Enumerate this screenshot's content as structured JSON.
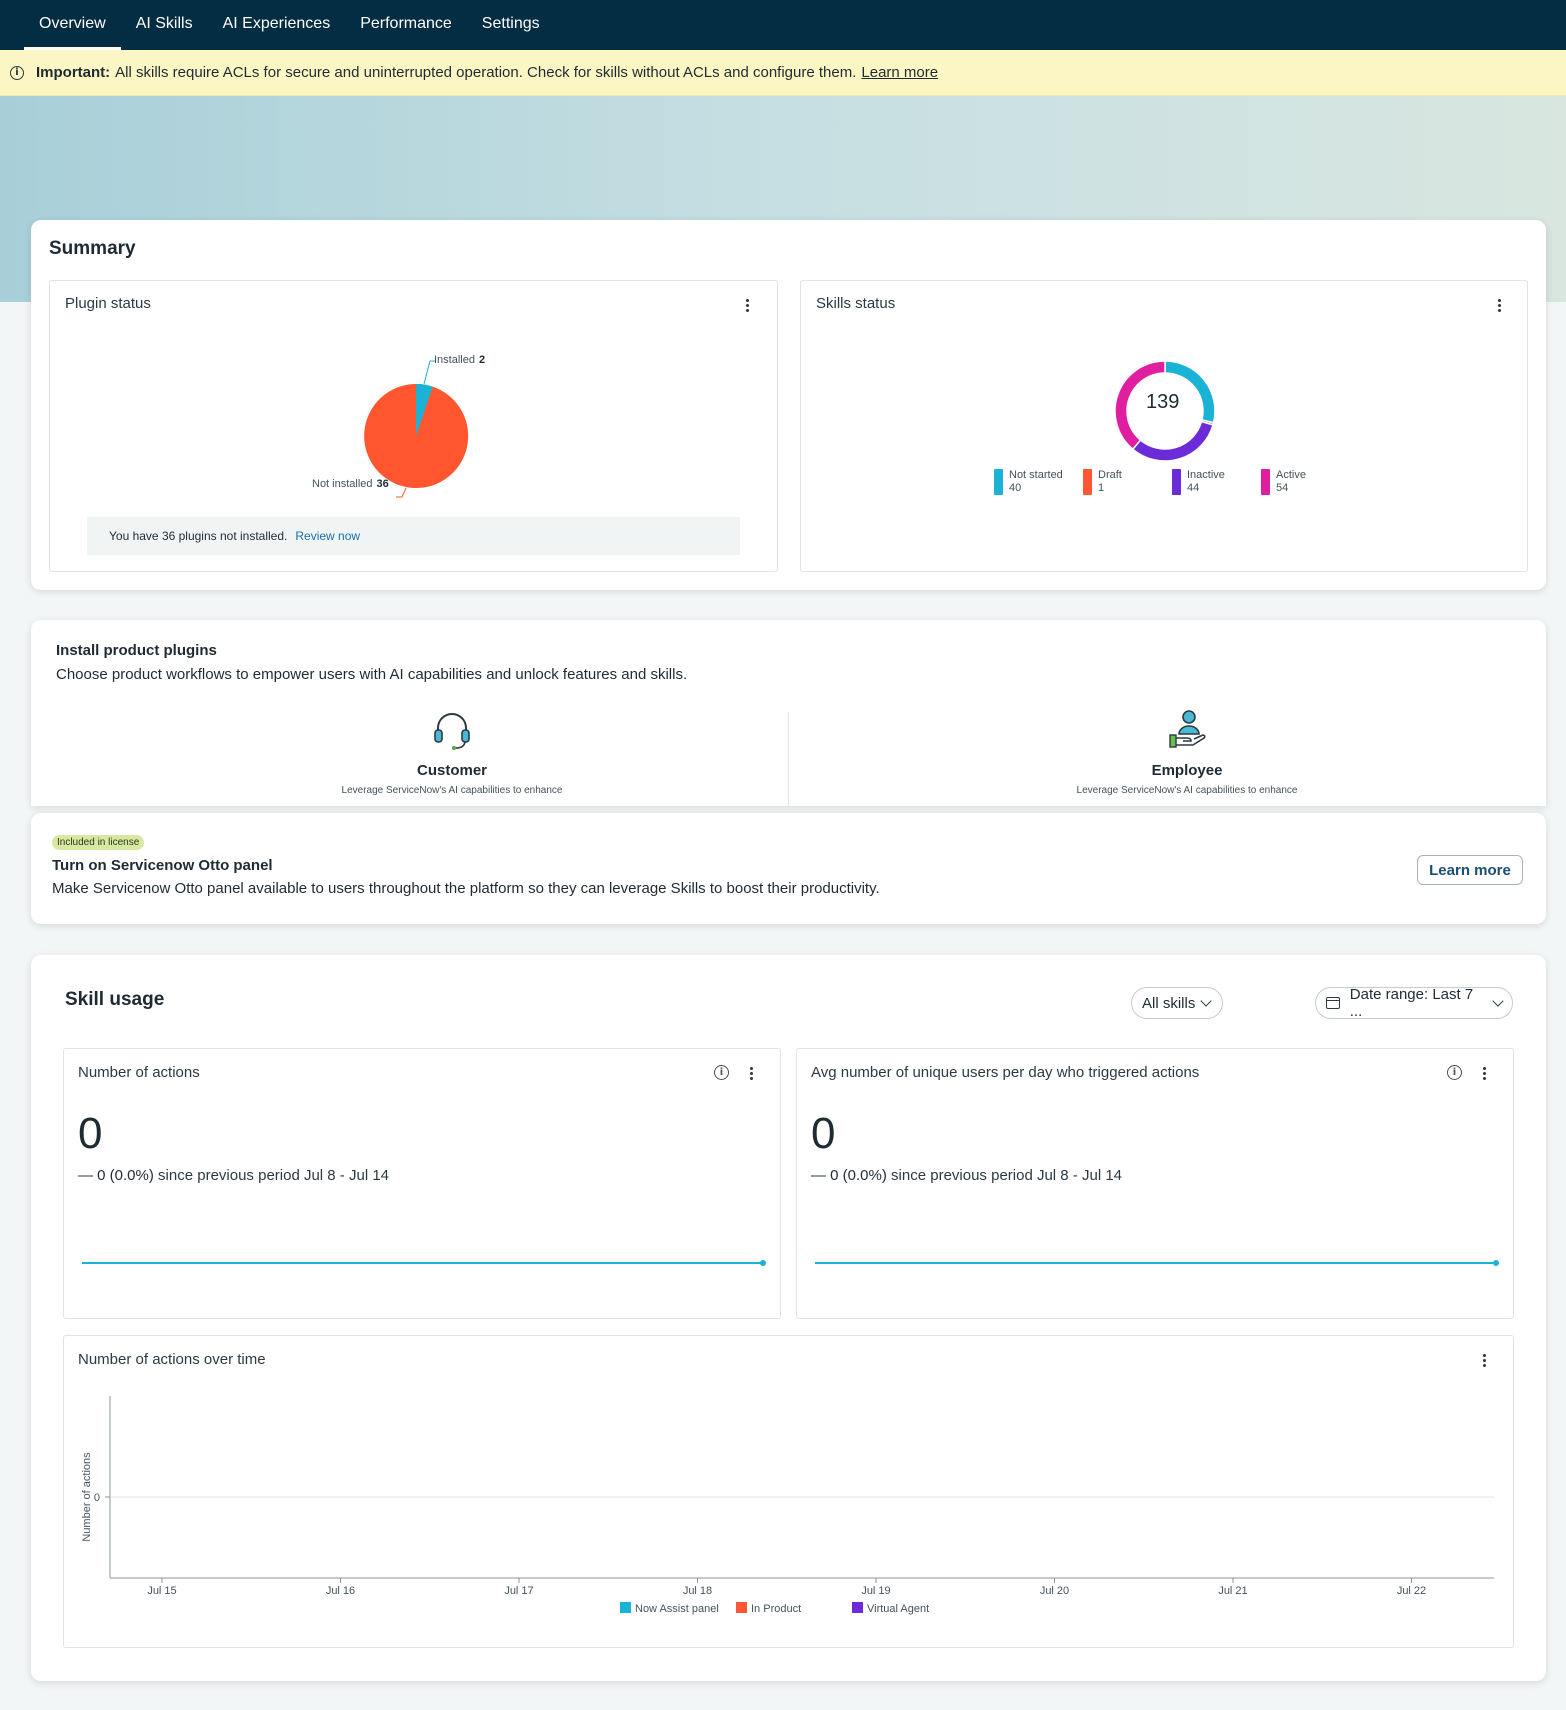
{
  "nav": {
    "tabs": [
      {
        "label": "Overview",
        "active": true
      },
      {
        "label": "AI Skills",
        "active": false
      },
      {
        "label": "AI Experiences",
        "active": false
      },
      {
        "label": "Performance",
        "active": false
      },
      {
        "label": "Settings",
        "active": false
      }
    ]
  },
  "banner": {
    "bold": "Important:",
    "text": "All skills require ACLs for secure and uninterrupted operation. Check for skills without ACLs and configure them.",
    "link": "Learn more"
  },
  "summary": {
    "title": "Summary",
    "plugin_status": {
      "title": "Plugin status",
      "installed_label": "Installed",
      "installed_value": "2",
      "not_installed_label": "Not installed",
      "not_installed_value": "36",
      "note": "You have 36 plugins not installed.",
      "note_link": "Review now"
    },
    "skills_status": {
      "title": "Skills status",
      "total": "139",
      "legend": [
        {
          "label": "Not started",
          "value": "40",
          "color": "#1ab3d6"
        },
        {
          "label": "Draft",
          "value": "1",
          "color": "#ff5733"
        },
        {
          "label": "Inactive",
          "value": "44",
          "color": "#6c2bd9"
        },
        {
          "label": "Active",
          "value": "54",
          "color": "#e01fa0"
        }
      ]
    }
  },
  "install": {
    "title": "Install product plugins",
    "desc": "Choose product workflows to empower users with AI capabilities and unlock features and skills.",
    "customer_title": "Customer",
    "customer_desc": "Leverage ServiceNow's AI capabilities to enhance",
    "employee_title": "Employee",
    "employee_desc": "Leverage ServiceNow's AI capabilities to enhance"
  },
  "otto": {
    "badge": "Included in license",
    "title": "Turn on Servicenow Otto panel",
    "desc": "Make Servicenow Otto panel available to users throughout the platform so they can leverage Skills to boost their productivity.",
    "button": "Learn more"
  },
  "skill_usage": {
    "title": "Skill usage",
    "filter": "All skills",
    "date_range": "Date range: Last 7 ...",
    "actions": {
      "title": "Number of actions",
      "value": "0",
      "dash": "—",
      "change": "0 (0.0%)",
      "since": "since previous period Jul 8 - Jul 14"
    },
    "avg_users": {
      "title": "Avg number of unique users per day who triggered actions",
      "value": "0",
      "dash": "—",
      "change": "0 (0.0%)",
      "since": "since previous period Jul 8 - Jul 14"
    },
    "over_time": {
      "title": "Number of actions over time"
    }
  },
  "chart_data": {
    "type": "line",
    "title": "Number of actions over time",
    "xlabel": "",
    "ylabel": "Number of actions",
    "x": [
      "Jul 15",
      "Jul 16",
      "Jul 17",
      "Jul 18",
      "Jul 19",
      "Jul 20",
      "Jul 21",
      "Jul 22"
    ],
    "y_ticks": [
      "0"
    ],
    "series": [
      {
        "name": "Now Assist panel",
        "color": "#1ab3d6",
        "values": [
          0,
          0,
          0,
          0,
          0,
          0,
          0,
          0
        ]
      },
      {
        "name": "In Product",
        "color": "#ff5733",
        "values": [
          0,
          0,
          0,
          0,
          0,
          0,
          0,
          0
        ]
      },
      {
        "name": "Virtual Agent",
        "color": "#6c2bd9",
        "values": [
          0,
          0,
          0,
          0,
          0,
          0,
          0,
          0
        ]
      }
    ],
    "legend": "bottom",
    "grid": true
  }
}
